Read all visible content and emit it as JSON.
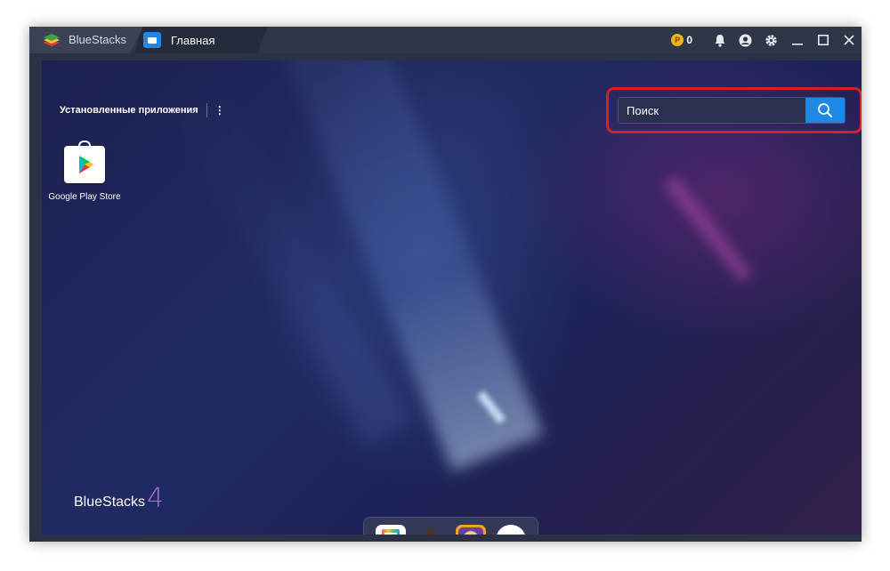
{
  "titlebar": {
    "app_name": "BlueStacks",
    "tab_home_label": "Главная",
    "coin_symbol": "P",
    "coin_count": "0"
  },
  "section": {
    "title": "Установленные приложения",
    "more_glyph": "⋮"
  },
  "apps": [
    {
      "label": "Google Play Store"
    }
  ],
  "search": {
    "placeholder": "Поиск"
  },
  "watermark": {
    "text": "BlueStacks",
    "number": "4"
  },
  "colors": {
    "accent_blue": "#1e88e5",
    "highlight_red": "#d81f26",
    "titlebar": "#2f3648",
    "coin": "#f2b01e"
  },
  "icons": [
    "bluestacks-logo-icon",
    "home-icon",
    "coin-icon",
    "bell-icon",
    "account-icon",
    "gear-icon",
    "minimize-icon",
    "maximize-icon",
    "close-icon",
    "search-icon",
    "play-store-icon"
  ]
}
